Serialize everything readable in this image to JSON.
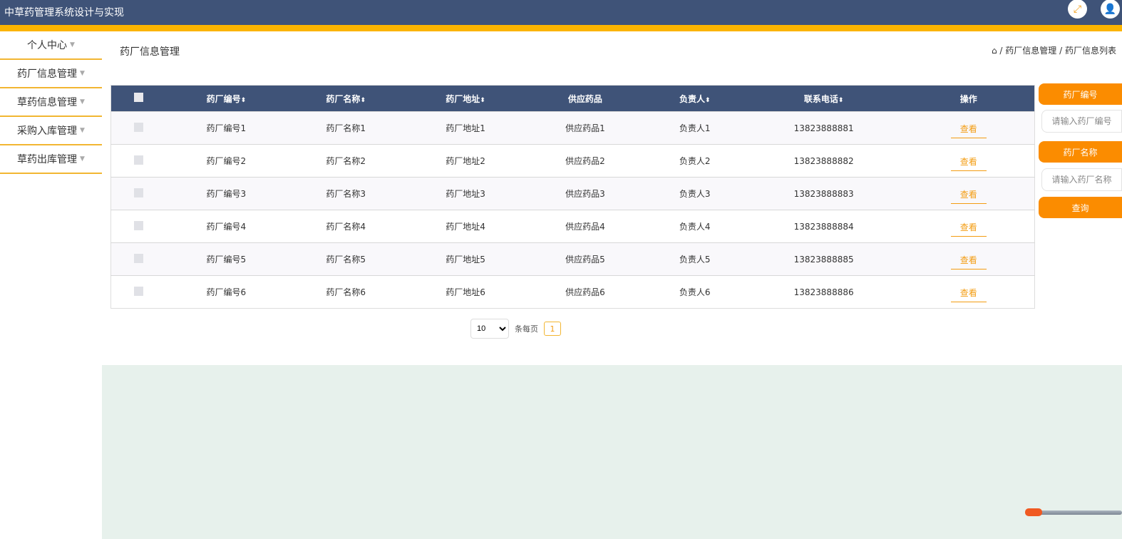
{
  "app": {
    "title": "中草药管理系统设计与实现",
    "icons": [
      "fullscreen-icon",
      "user-icon"
    ]
  },
  "sidebar": {
    "items": [
      {
        "label": "个人中心"
      },
      {
        "label": "药厂信息管理"
      },
      {
        "label": "草药信息管理"
      },
      {
        "label": "采购入库管理"
      },
      {
        "label": "草药出库管理"
      }
    ]
  },
  "page": {
    "title": "药厂信息管理",
    "breadcrumb": [
      "药厂信息管理",
      "药厂信息列表"
    ],
    "sep": "/"
  },
  "table": {
    "headers": [
      "药厂编号",
      "药厂名称",
      "药厂地址",
      "供应药品",
      "负责人",
      "联系电话",
      "操作"
    ],
    "sort_mark": "⬍",
    "rows": [
      [
        "药厂编号1",
        "药厂名称1",
        "药厂地址1",
        "供应药品1",
        "负责人1",
        "13823888881"
      ],
      [
        "药厂编号2",
        "药厂名称2",
        "药厂地址2",
        "供应药品2",
        "负责人2",
        "13823888882"
      ],
      [
        "药厂编号3",
        "药厂名称3",
        "药厂地址3",
        "供应药品3",
        "负责人3",
        "13823888883"
      ],
      [
        "药厂编号4",
        "药厂名称4",
        "药厂地址4",
        "供应药品4",
        "负责人4",
        "13823888884"
      ],
      [
        "药厂编号5",
        "药厂名称5",
        "药厂地址5",
        "供应药品5",
        "负责人5",
        "13823888885"
      ],
      [
        "药厂编号6",
        "药厂名称6",
        "药厂地址6",
        "供应药品6",
        "负责人6",
        "13823888886"
      ]
    ],
    "action": "查看"
  },
  "search": {
    "label1": "药厂编号",
    "placeholder1": "请输入药厂编号",
    "label2": "药厂名称",
    "placeholder2": "请输入药厂名称",
    "button": "查询"
  },
  "pager": {
    "page_size": "10",
    "per_page_label": "条每页",
    "current": "1"
  }
}
